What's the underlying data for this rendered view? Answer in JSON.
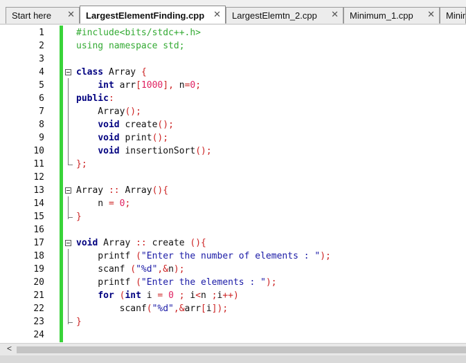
{
  "tabs": [
    {
      "label": "Start here",
      "active": false
    },
    {
      "label": "LargestElementFinding.cpp",
      "active": true
    },
    {
      "label": "LargestElemtn_2.cpp",
      "active": false
    },
    {
      "label": "Minimum_1.cpp",
      "active": false
    },
    {
      "label": "Minimu",
      "active": false
    }
  ],
  "close_glyph": "✕",
  "editor": {
    "lines": [
      {
        "n": "1",
        "tokens": [
          {
            "t": "#include<bits/stdc++.h>",
            "c": "pre"
          }
        ]
      },
      {
        "n": "2",
        "tokens": [
          {
            "t": "using namespace std;",
            "c": "pre"
          }
        ]
      },
      {
        "n": "3",
        "tokens": []
      },
      {
        "n": "4",
        "tokens": [
          {
            "t": "class",
            "c": "kw"
          },
          {
            "t": " Array ",
            "c": "id"
          },
          {
            "t": "{",
            "c": "op"
          }
        ]
      },
      {
        "n": "5",
        "tokens": [
          {
            "t": "    ",
            "c": "id"
          },
          {
            "t": "int",
            "c": "kw"
          },
          {
            "t": " arr",
            "c": "id"
          },
          {
            "t": "[",
            "c": "op"
          },
          {
            "t": "1000",
            "c": "num"
          },
          {
            "t": "],",
            "c": "op"
          },
          {
            "t": " n",
            "c": "id"
          },
          {
            "t": "=",
            "c": "op"
          },
          {
            "t": "0",
            "c": "num"
          },
          {
            "t": ";",
            "c": "op"
          }
        ]
      },
      {
        "n": "6",
        "tokens": [
          {
            "t": "public",
            "c": "kw"
          },
          {
            "t": ":",
            "c": "op"
          }
        ]
      },
      {
        "n": "7",
        "tokens": [
          {
            "t": "    Array",
            "c": "id"
          },
          {
            "t": "();",
            "c": "op"
          }
        ]
      },
      {
        "n": "8",
        "tokens": [
          {
            "t": "    ",
            "c": "id"
          },
          {
            "t": "void",
            "c": "kw"
          },
          {
            "t": " create",
            "c": "id"
          },
          {
            "t": "();",
            "c": "op"
          }
        ]
      },
      {
        "n": "9",
        "tokens": [
          {
            "t": "    ",
            "c": "id"
          },
          {
            "t": "void",
            "c": "kw"
          },
          {
            "t": " print",
            "c": "id"
          },
          {
            "t": "();",
            "c": "op"
          }
        ]
      },
      {
        "n": "10",
        "tokens": [
          {
            "t": "    ",
            "c": "id"
          },
          {
            "t": "void",
            "c": "kw"
          },
          {
            "t": " insertionSort",
            "c": "id"
          },
          {
            "t": "();",
            "c": "op"
          }
        ]
      },
      {
        "n": "11",
        "tokens": [
          {
            "t": "};",
            "c": "op"
          }
        ]
      },
      {
        "n": "12",
        "tokens": []
      },
      {
        "n": "13",
        "tokens": [
          {
            "t": "Array ",
            "c": "id"
          },
          {
            "t": "::",
            "c": "op"
          },
          {
            "t": " Array",
            "c": "id"
          },
          {
            "t": "(){",
            "c": "op"
          }
        ]
      },
      {
        "n": "14",
        "tokens": [
          {
            "t": "    n ",
            "c": "id"
          },
          {
            "t": "=",
            "c": "op"
          },
          {
            "t": " ",
            "c": "id"
          },
          {
            "t": "0",
            "c": "num"
          },
          {
            "t": ";",
            "c": "op"
          }
        ]
      },
      {
        "n": "15",
        "tokens": [
          {
            "t": "}",
            "c": "op"
          }
        ]
      },
      {
        "n": "16",
        "tokens": []
      },
      {
        "n": "17",
        "tokens": [
          {
            "t": "void",
            "c": "kw"
          },
          {
            "t": " Array ",
            "c": "id"
          },
          {
            "t": "::",
            "c": "op"
          },
          {
            "t": " create ",
            "c": "id"
          },
          {
            "t": "(){",
            "c": "op"
          }
        ]
      },
      {
        "n": "18",
        "tokens": [
          {
            "t": "    printf ",
            "c": "id"
          },
          {
            "t": "(",
            "c": "op"
          },
          {
            "t": "\"Enter the number of elements : \"",
            "c": "str"
          },
          {
            "t": ");",
            "c": "op"
          }
        ]
      },
      {
        "n": "19",
        "tokens": [
          {
            "t": "    scanf ",
            "c": "id"
          },
          {
            "t": "(",
            "c": "op"
          },
          {
            "t": "\"%d\"",
            "c": "str"
          },
          {
            "t": ",&",
            "c": "op"
          },
          {
            "t": "n",
            "c": "id"
          },
          {
            "t": ");",
            "c": "op"
          }
        ]
      },
      {
        "n": "20",
        "tokens": [
          {
            "t": "    printf ",
            "c": "id"
          },
          {
            "t": "(",
            "c": "op"
          },
          {
            "t": "\"Enter the elements : \"",
            "c": "str"
          },
          {
            "t": ");",
            "c": "op"
          }
        ]
      },
      {
        "n": "21",
        "tokens": [
          {
            "t": "    ",
            "c": "id"
          },
          {
            "t": "for",
            "c": "kw"
          },
          {
            "t": " ",
            "c": "id"
          },
          {
            "t": "(",
            "c": "op"
          },
          {
            "t": "int",
            "c": "kw"
          },
          {
            "t": " i ",
            "c": "id"
          },
          {
            "t": "=",
            "c": "op"
          },
          {
            "t": " ",
            "c": "id"
          },
          {
            "t": "0",
            "c": "num"
          },
          {
            "t": " ; ",
            "c": "op"
          },
          {
            "t": "i",
            "c": "id"
          },
          {
            "t": "<",
            "c": "op"
          },
          {
            "t": "n ",
            "c": "id"
          },
          {
            "t": ";",
            "c": "op"
          },
          {
            "t": "i",
            "c": "id"
          },
          {
            "t": "++)",
            "c": "op"
          }
        ]
      },
      {
        "n": "22",
        "tokens": [
          {
            "t": "        scanf",
            "c": "id"
          },
          {
            "t": "(",
            "c": "op"
          },
          {
            "t": "\"%d\"",
            "c": "str"
          },
          {
            "t": ",&",
            "c": "op"
          },
          {
            "t": "arr",
            "c": "id"
          },
          {
            "t": "[",
            "c": "op"
          },
          {
            "t": "i",
            "c": "id"
          },
          {
            "t": "]);",
            "c": "op"
          }
        ]
      },
      {
        "n": "23",
        "tokens": [
          {
            "t": "}",
            "c": "op"
          }
        ]
      },
      {
        "n": "24",
        "tokens": []
      }
    ]
  },
  "scrollbar": {
    "left_arrow": "<"
  },
  "colors": {
    "preprocessor": "#33aa33",
    "keyword": "#000080",
    "number": "#e02060",
    "operator": "#cc2222",
    "string": "#1a1aa6",
    "change_bar": "#39d339"
  }
}
